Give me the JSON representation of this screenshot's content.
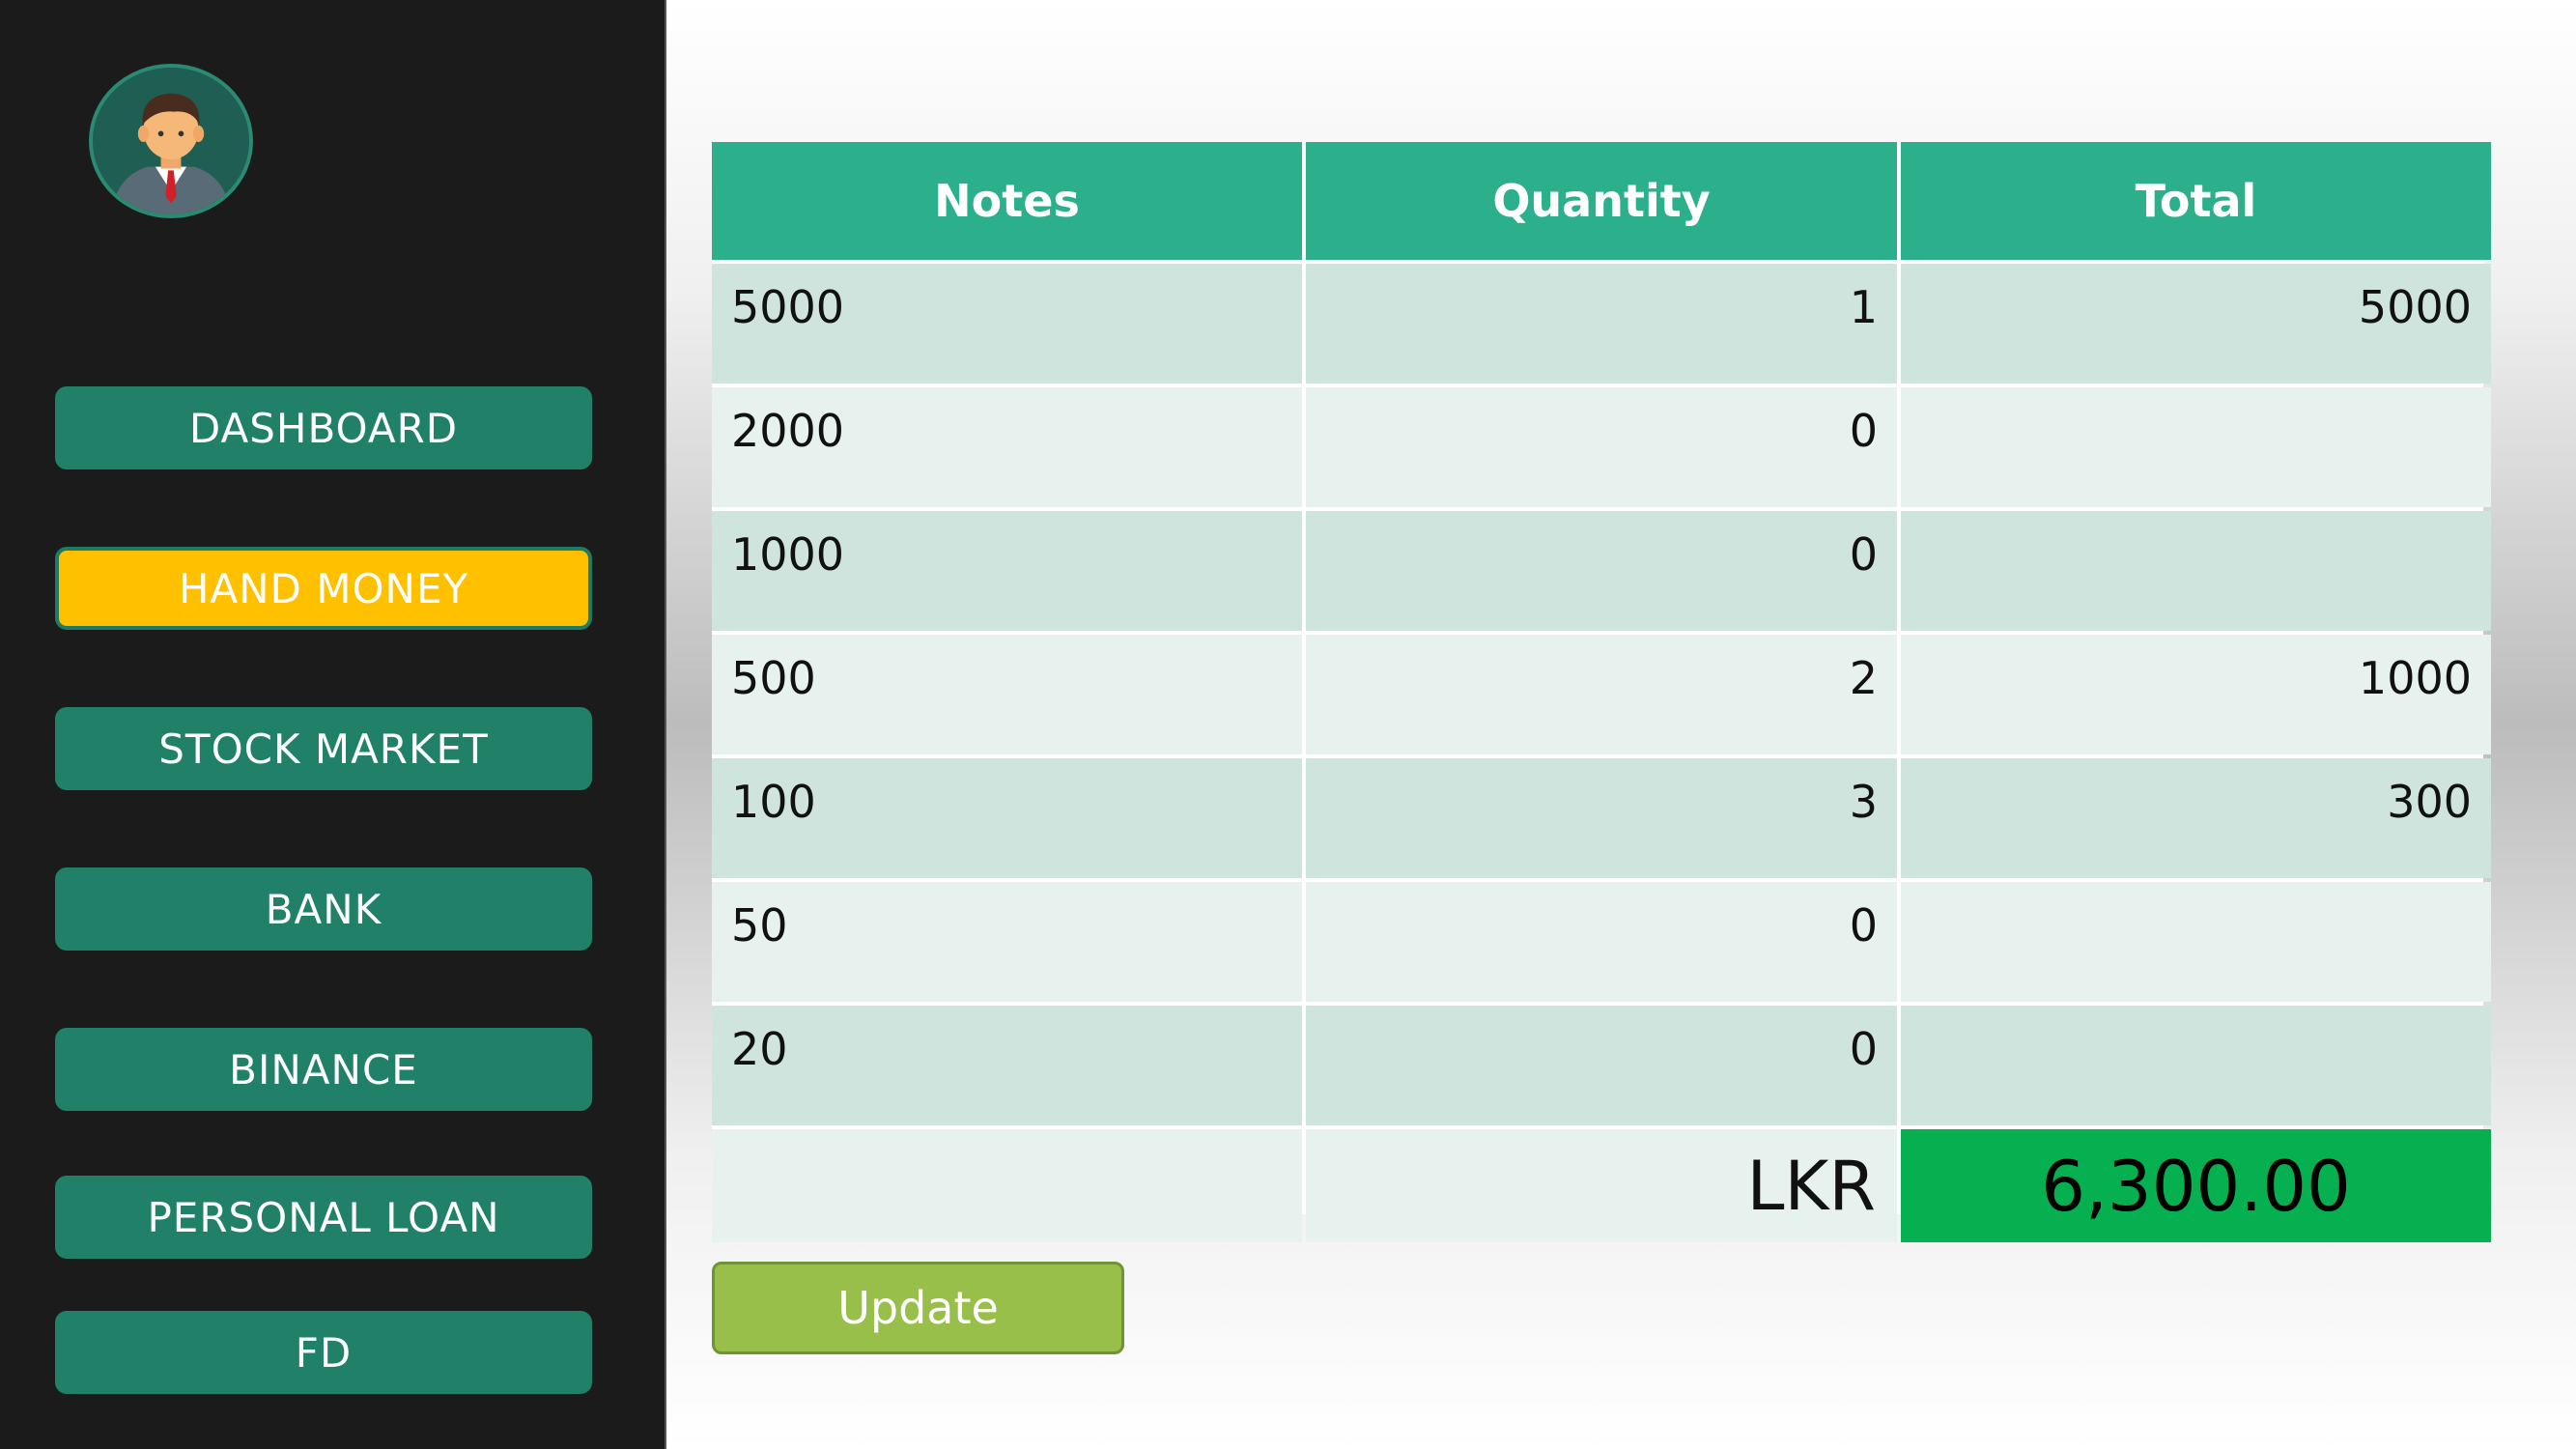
{
  "sidebar": {
    "avatar_icon": "businessman-avatar-icon",
    "nav": [
      {
        "label": "DASHBOARD",
        "active": false
      },
      {
        "label": "HAND MONEY",
        "active": true
      },
      {
        "label": "STOCK MARKET",
        "active": false
      },
      {
        "label": "BANK",
        "active": false
      },
      {
        "label": "BINANCE",
        "active": false
      },
      {
        "label": "PERSONAL LOAN",
        "active": false
      },
      {
        "label": "FD",
        "active": false
      }
    ]
  },
  "table": {
    "headers": [
      "Notes",
      "Quantity",
      "Total"
    ],
    "rows": [
      {
        "note": "5000",
        "quantity": "1",
        "total": "5000"
      },
      {
        "note": "2000",
        "quantity": "0",
        "total": ""
      },
      {
        "note": "1000",
        "quantity": "0",
        "total": ""
      },
      {
        "note": "500",
        "quantity": "2",
        "total": "1000"
      },
      {
        "note": "100",
        "quantity": "3",
        "total": "300"
      },
      {
        "note": "50",
        "quantity": "0",
        "total": ""
      },
      {
        "note": "20",
        "quantity": "0",
        "total": ""
      }
    ],
    "currency": "LKR",
    "grand_total": "6,300.00"
  },
  "actions": {
    "update_label": "Update"
  },
  "colors": {
    "sidebar_bg": "#1b1b1b",
    "nav_button": "#208168",
    "nav_active": "#ffc000",
    "header_bg": "#2cb08c",
    "total_bg": "#06b050",
    "update_button": "#98bf4a"
  }
}
